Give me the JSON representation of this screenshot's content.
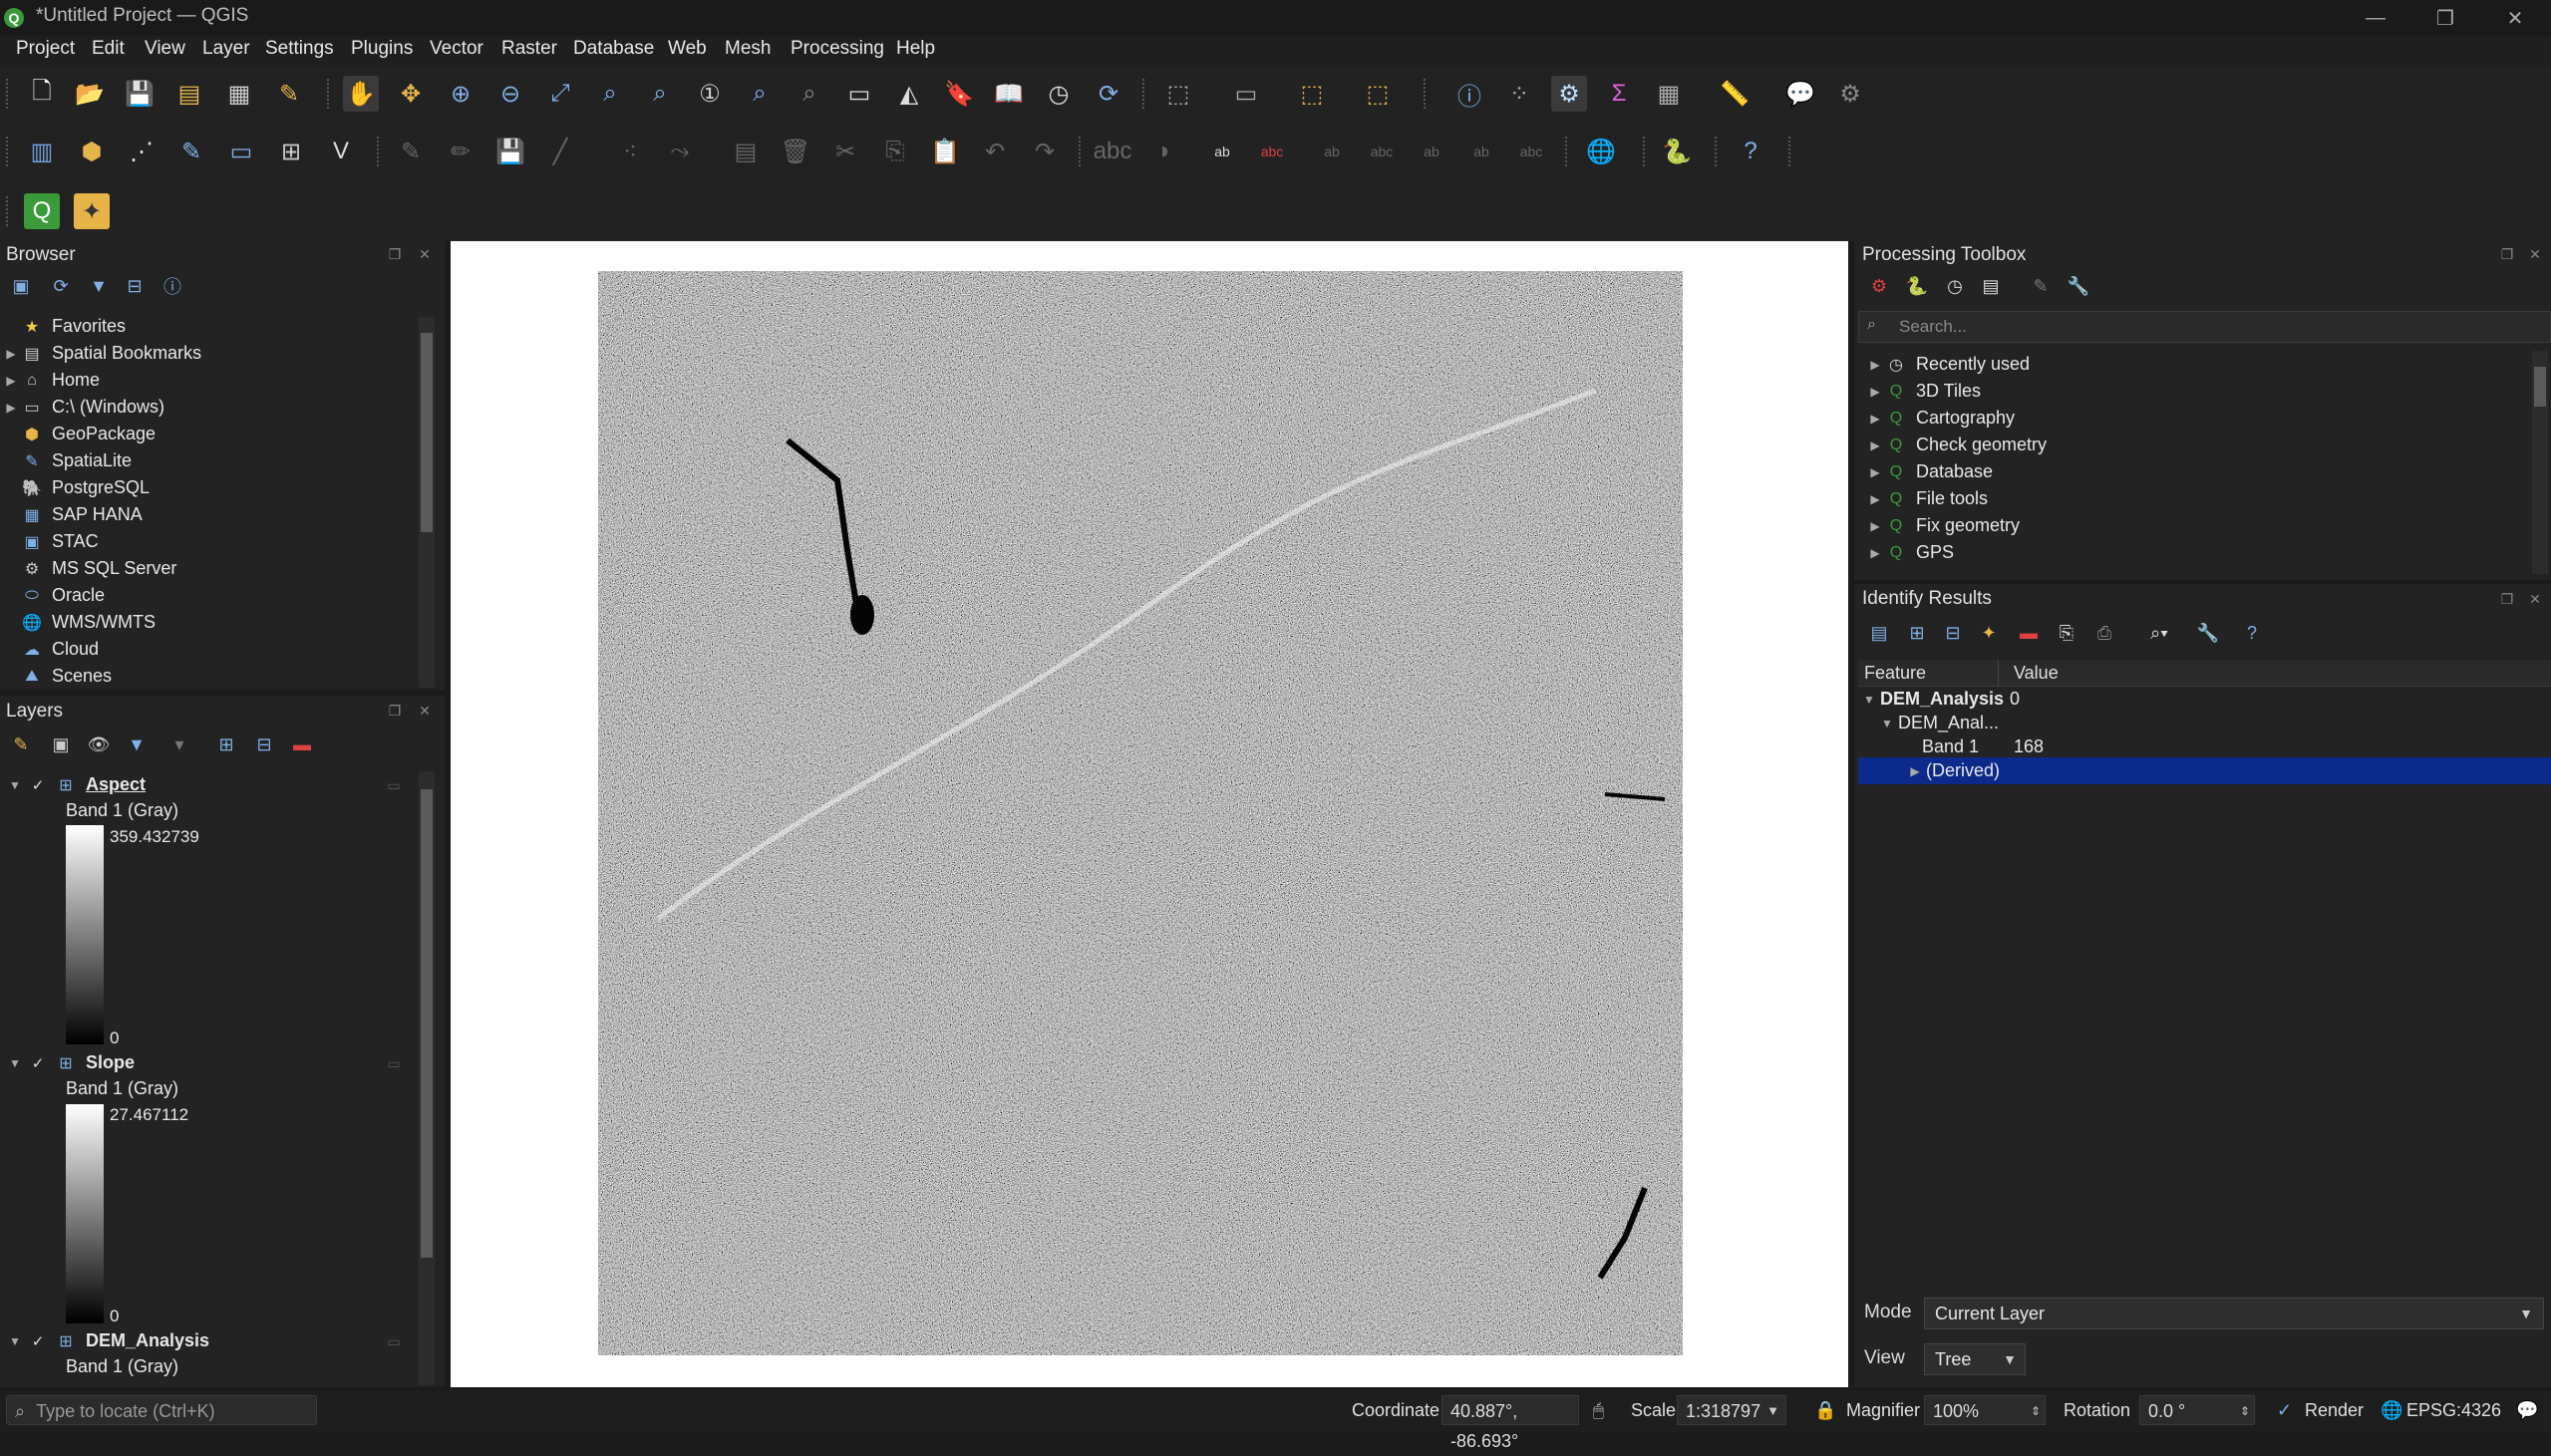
{
  "window": {
    "title": "*Untitled Project — QGIS",
    "minimize": "—",
    "maximize": "❐",
    "close": "✕"
  },
  "menu": [
    "Project",
    "Edit",
    "View",
    "Layer",
    "Settings",
    "Plugins",
    "Vector",
    "Raster",
    "Database",
    "Web",
    "Mesh",
    "Processing",
    "Help"
  ],
  "browser": {
    "title": "Browser",
    "items": [
      {
        "label": "Favorites",
        "icon": "star-icon"
      },
      {
        "label": "Spatial Bookmarks",
        "icon": "bookmark-icon"
      },
      {
        "label": "Home",
        "icon": "home-folder-icon"
      },
      {
        "label": "C:\\ (Windows)",
        "icon": "drive-icon"
      },
      {
        "label": "GeoPackage",
        "icon": "geopackage-icon"
      },
      {
        "label": "SpatiaLite",
        "icon": "spatialite-icon"
      },
      {
        "label": "PostgreSQL",
        "icon": "postgresql-icon"
      },
      {
        "label": "SAP HANA",
        "icon": "sap-hana-icon"
      },
      {
        "label": "STAC",
        "icon": "stac-icon"
      },
      {
        "label": "MS SQL Server",
        "icon": "mssql-icon"
      },
      {
        "label": "Oracle",
        "icon": "oracle-icon"
      },
      {
        "label": "WMS/WMTS",
        "icon": "wms-icon"
      },
      {
        "label": "Cloud",
        "icon": "cloud-icon"
      },
      {
        "label": "Scenes",
        "icon": "scenes-icon"
      }
    ]
  },
  "layers": {
    "title": "Layers",
    "items": [
      {
        "name": "Aspect",
        "band": "Band 1 (Gray)",
        "max": "359.432739",
        "min": "0"
      },
      {
        "name": "Slope",
        "band": "Band 1 (Gray)",
        "max": "27.467112",
        "min": "0"
      },
      {
        "name": "DEM_Analysis",
        "band": "Band 1 (Gray)"
      }
    ]
  },
  "processing": {
    "title": "Processing Toolbox",
    "search_placeholder": "Search...",
    "items": [
      "Recently used",
      "3D Tiles",
      "Cartography",
      "Check geometry",
      "Database",
      "File tools",
      "Fix geometry",
      "GPS"
    ]
  },
  "identify": {
    "title": "Identify Results",
    "col_feature": "Feature",
    "col_value": "Value",
    "rows": [
      {
        "feature": "DEM_Analysis",
        "value": "0"
      },
      {
        "feature": "DEM_Anal...",
        "value": ""
      },
      {
        "feature": "Band 1",
        "value": "168"
      },
      {
        "feature": "(Derived)",
        "value": ""
      }
    ],
    "mode_label": "Mode",
    "mode_value": "Current Layer",
    "view_label": "View",
    "view_value": "Tree"
  },
  "status": {
    "locate_placeholder": "Type to locate (Ctrl+K)",
    "coordinate_label": "Coordinate",
    "coordinate_value": "40.887°, -86.693°",
    "scale_label": "Scale",
    "scale_value": "1:318797",
    "magnifier_label": "Magnifier",
    "magnifier_value": "100%",
    "rotation_label": "Rotation",
    "rotation_value": "0.0 °",
    "render_label": "Render",
    "crs": "EPSG:4326"
  },
  "colors": {
    "selection": "#0b2a8a",
    "accent_green": "#3a9a3a"
  }
}
